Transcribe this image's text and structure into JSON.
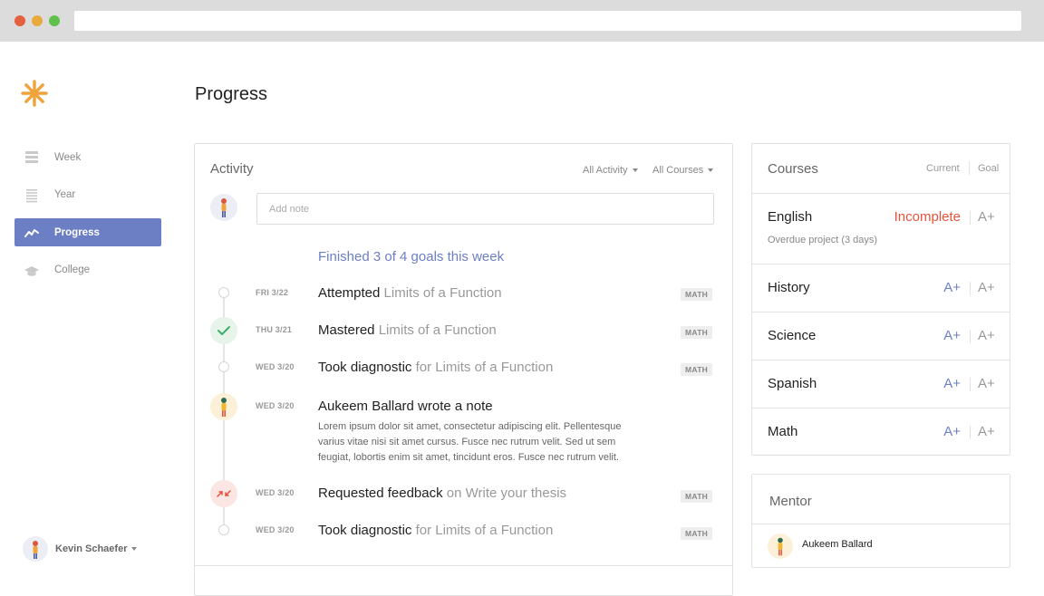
{
  "browser": {
    "url": ""
  },
  "sidebar": {
    "items": [
      {
        "label": "Week",
        "icon": "week-icon",
        "active": false
      },
      {
        "label": "Year",
        "icon": "year-icon",
        "active": false
      },
      {
        "label": "Progress",
        "icon": "progress-icon",
        "active": true
      },
      {
        "label": "College",
        "icon": "college-icon",
        "active": false
      }
    ],
    "user": {
      "name": "Kevin Schaefer"
    }
  },
  "page": {
    "title": "Progress"
  },
  "activity": {
    "title": "Activity",
    "filters": [
      "All Activity",
      "All Courses"
    ],
    "note_placeholder": "Add note",
    "goals_summary": "Finished 3 of 4 goals this week",
    "entries": [
      {
        "date": "FRI 3/22",
        "action": "Attempted",
        "detail": " Limits of a Function",
        "tag": "MATH"
      },
      {
        "date": "THU 3/21",
        "action": "Mastered",
        "detail": " Limits of a Function",
        "tag": "MATH"
      },
      {
        "date": "WED 3/20",
        "action": "Took diagnostic",
        "detail": " for Limits of a Function",
        "tag": "MATH"
      },
      {
        "date": "WED 3/20",
        "action": "Aukeem Ballard wrote a note",
        "detail": "",
        "body": "Lorem ipsum dolor sit amet, consectetur adipiscing elit. Pellentesque varius vitae nisi sit amet cursus. Fusce nec rutrum velit. Sed ut sem feugiat, lobortis enim sit amet, tincidunt eros. Fusce nec rutrum velit."
      },
      {
        "date": "WED 3/20",
        "action": "Requested feedback",
        "detail": " on Write your thesis",
        "tag": "MATH"
      },
      {
        "date": "WED 3/20",
        "action": "Took diagnostic",
        "detail": " for Limits of a Function",
        "tag": "MATH"
      }
    ]
  },
  "courses": {
    "title": "Courses",
    "col_current": "Current",
    "col_goal": "Goal",
    "rows": [
      {
        "name": "English",
        "current": "Incomplete",
        "goal": "A+",
        "note": "Overdue project (3 days)"
      },
      {
        "name": "History",
        "current": "A+",
        "goal": "A+"
      },
      {
        "name": "Science",
        "current": "A+",
        "goal": "A+"
      },
      {
        "name": "Spanish",
        "current": "A+",
        "goal": "A+"
      },
      {
        "name": "Math",
        "current": "A+",
        "goal": "A+"
      }
    ]
  },
  "mentor": {
    "title": "Mentor",
    "name": "Aukeem Ballard"
  },
  "colors": {
    "accent": "#6c7fc4",
    "warning": "#e5533b",
    "logo": "#f0a23b",
    "success": "#3fae6a"
  }
}
